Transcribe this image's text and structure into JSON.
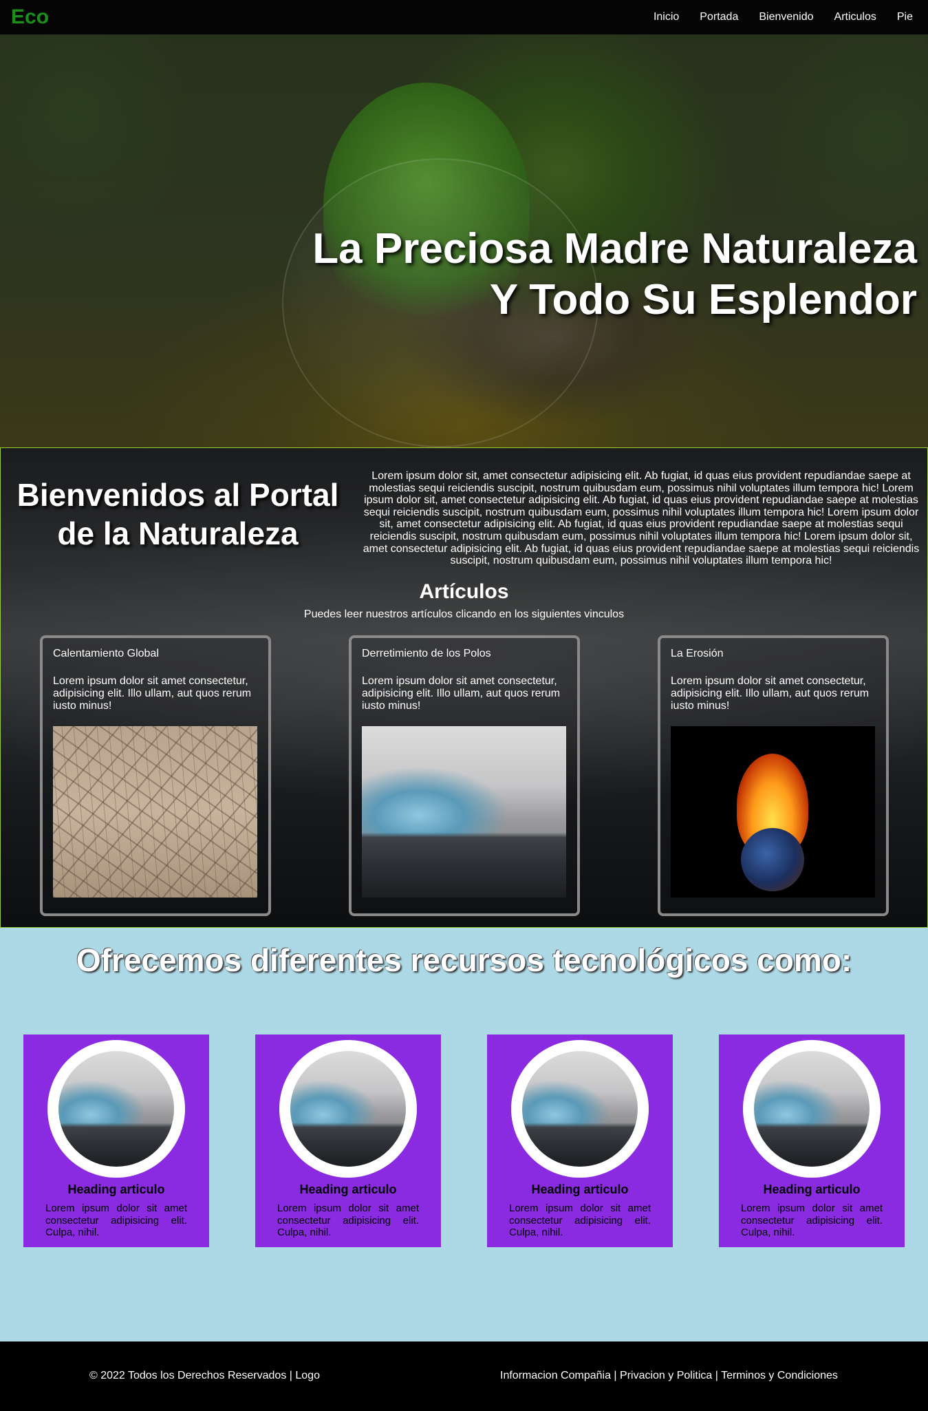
{
  "nav": {
    "logo": "Eco",
    "links": [
      "Inicio",
      "Portada",
      "Bienvenido",
      "Articulos",
      "Pie"
    ]
  },
  "hero": {
    "title_line1": "La Preciosa Madre Naturaleza",
    "title_line2": "Y Todo Su Esplendor"
  },
  "welcome": {
    "title": "Bienvenidos al Portal de la Naturaleza",
    "text": "Lorem ipsum dolor sit, amet consectetur adipisicing elit. Ab fugiat, id quas eius provident repudiandae saepe at molestias sequi reiciendis suscipit, nostrum quibusdam eum, possimus nihil voluptates illum tempora hic! Lorem ipsum dolor sit, amet consectetur adipisicing elit. Ab fugiat, id quas eius provident repudiandae saepe at molestias sequi reiciendis suscipit, nostrum quibusdam eum, possimus nihil voluptates illum tempora hic! Lorem ipsum dolor sit, amet consectetur adipisicing elit. Ab fugiat, id quas eius provident repudiandae saepe at molestias sequi reiciendis suscipit, nostrum quibusdam eum, possimus nihil voluptates illum tempora hic! Lorem ipsum dolor sit, amet consectetur adipisicing elit. Ab fugiat, id quas eius provident repudiandae saepe at molestias sequi reiciendis suscipit, nostrum quibusdam eum, possimus nihil voluptates illum tempora hic!"
  },
  "articles": {
    "heading": "Artículos",
    "subheading": "Puedes leer nuestros artículos clicando en los siguientes vinculos",
    "cards": [
      {
        "title": "Calentamiento Global",
        "text": "Lorem ipsum dolor sit amet consectetur, adipisicing elit. Illo ullam, aut quos rerum iusto minus!",
        "image": "cracked-earth"
      },
      {
        "title": "Derretimiento de los Polos",
        "text": "Lorem ipsum dolor sit amet consectetur, adipisicing elit. Illo ullam, aut quos rerum iusto minus!",
        "image": "glacier"
      },
      {
        "title": "La Erosión",
        "text": "Lorem ipsum dolor sit amet consectetur, adipisicing elit. Illo ullam, aut quos rerum iusto minus!",
        "image": "burning-earth"
      }
    ]
  },
  "resources": {
    "title": "Ofrecemos diferentes recursos tecnológicos como:",
    "cards": [
      {
        "heading": "Heading articulo",
        "text": "Lorem ipsum dolor sit amet consectetur adipisicing elit. Culpa, nihil."
      },
      {
        "heading": "Heading articulo",
        "text": "Lorem ipsum dolor sit amet consectetur adipisicing elit. Culpa, nihil."
      },
      {
        "heading": "Heading articulo",
        "text": "Lorem ipsum dolor sit amet consectetur adipisicing elit. Culpa, nihil."
      },
      {
        "heading": "Heading articulo",
        "text": "Lorem ipsum dolor sit amet consectetur adipisicing elit. Culpa, nihil."
      }
    ]
  },
  "footer": {
    "left": "© 2022 Todos los Derechos Reservados | Logo",
    "links": [
      "Informacion Compañia",
      "Privacion y Politica",
      "Terminos y Condiciones"
    ],
    "separator": " | "
  },
  "colors": {
    "logo": "#1a8f1a",
    "welcome_border": "#9acd32",
    "resources_bg": "#add8e6",
    "resource_card": "#8a2be2",
    "footer_bg": "#000000"
  }
}
